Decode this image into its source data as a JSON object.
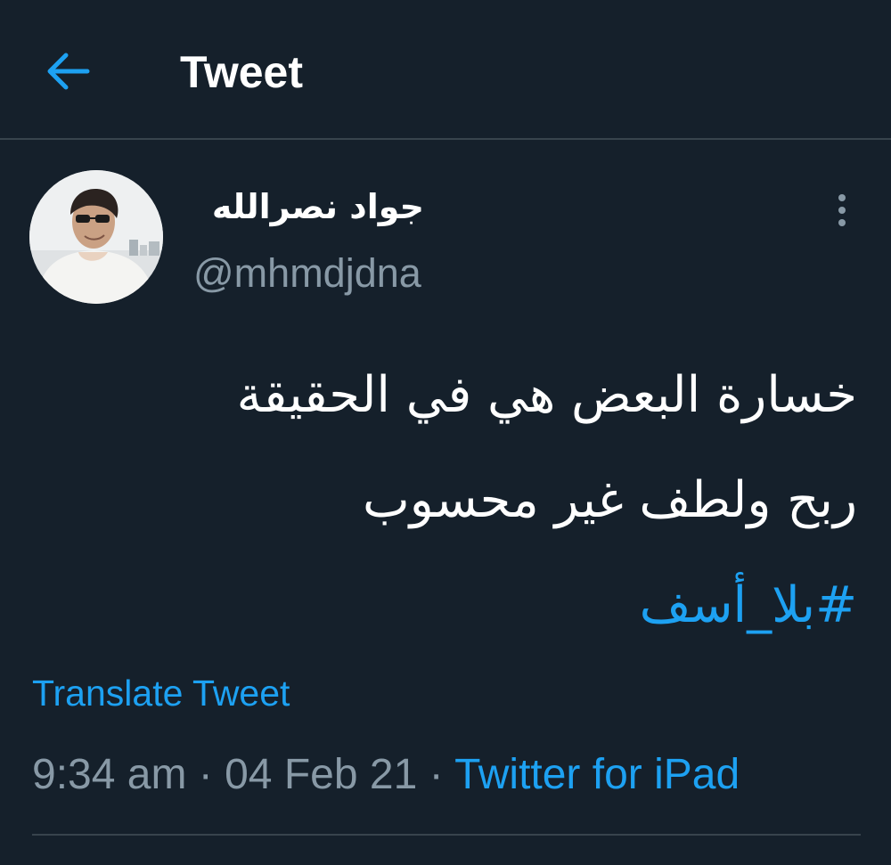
{
  "header": {
    "title": "Tweet",
    "back_icon": "arrow-left-icon",
    "accent": "#1da1f2"
  },
  "author": {
    "display_name": "جواد نصرالله",
    "handle": "@mhmdjdna",
    "avatar_icon": "profile-photo",
    "more_icon": "vertical-ellipsis-icon"
  },
  "tweet": {
    "lines": [
      "خسارة البعض هي في الحقيقة",
      "ربح ولطف غير محسوب"
    ],
    "hashtag": "#بلا_أسف"
  },
  "translate_label": "Translate Tweet",
  "meta": {
    "time": "9:34 am",
    "sep1": " · ",
    "date": "04 Feb 21",
    "sep2": " · ",
    "source": "Twitter for iPad"
  },
  "colors": {
    "background": "#15202b",
    "text": "#ffffff",
    "secondary": "#8899a6",
    "link": "#1da1f2",
    "divider": "#38444d"
  }
}
